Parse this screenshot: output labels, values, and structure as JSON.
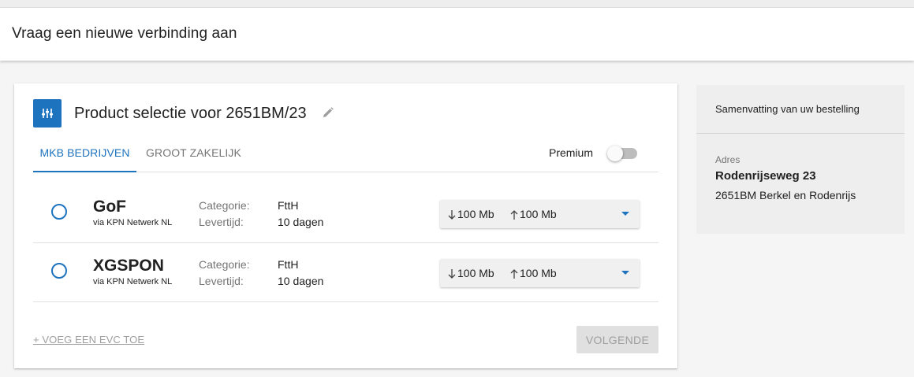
{
  "page": {
    "title": "Vraag een nieuwe verbinding aan"
  },
  "card": {
    "title": "Product selectie voor 2651BM/23",
    "icon": "equalizer-sliders-icon",
    "edit_icon": "pencil-icon",
    "tabs": [
      {
        "label": "MKB BEDRIJVEN",
        "active": true
      },
      {
        "label": "GROOT ZAKELIJK",
        "active": false
      }
    ],
    "premium": {
      "label": "Premium",
      "on": false
    },
    "products": [
      {
        "name": "GoF",
        "via": "via KPN Netwerk NL",
        "categorie_label": "Categorie:",
        "categorie": "FttH",
        "levertijd_label": "Levertijd:",
        "levertijd": "10 dagen",
        "download": "100 Mb",
        "upload": "100 Mb",
        "selected": false
      },
      {
        "name": "XGSPON",
        "via": "via KPN Netwerk NL",
        "categorie_label": "Categorie:",
        "categorie": "FttH",
        "levertijd_label": "Levertijd:",
        "levertijd": "10 dagen",
        "download": "100 Mb",
        "upload": "100 Mb",
        "selected": false
      }
    ],
    "add_evc_label": "+ VOEG EEN EVC TOE",
    "next_label": "VOLGENDE"
  },
  "summary": {
    "title": "Samenvatting van uw bestelling",
    "adres_label": "Adres",
    "street": "Rodenrijseweg 23",
    "city": "2651BM Berkel en Rodenrijs"
  },
  "colors": {
    "accent": "#1e73be",
    "disabled_button": "#e0e0e0",
    "summary_background": "#eeeeee"
  }
}
